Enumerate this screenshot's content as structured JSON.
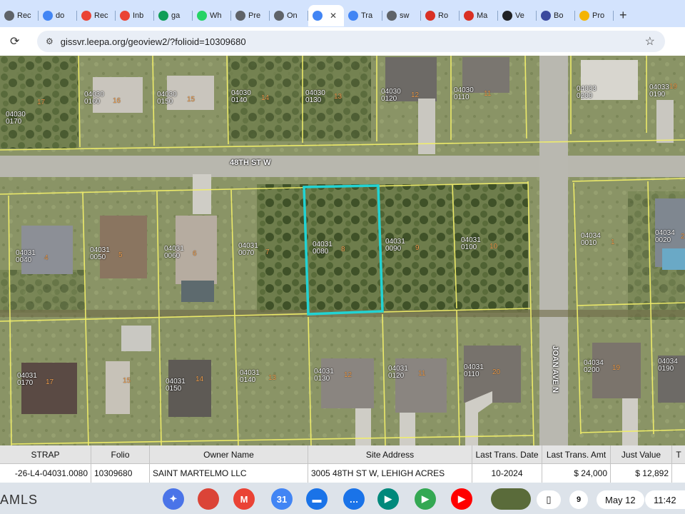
{
  "browser": {
    "tabs": [
      {
        "label": "Rec",
        "icon": "page-icon",
        "color": "#5f6368"
      },
      {
        "label": "do",
        "icon": "smiley-icon",
        "color": "#4285f4"
      },
      {
        "label": "Rec",
        "icon": "gmail-icon",
        "color": "#ea4335"
      },
      {
        "label": "Inb",
        "icon": "gmail-icon",
        "color": "#ea4335"
      },
      {
        "label": "ga",
        "icon": "sheets-icon",
        "color": "#0f9d58"
      },
      {
        "label": "Wh",
        "icon": "whatsapp-icon",
        "color": "#25d366"
      },
      {
        "label": "Pre",
        "icon": "globe-icon",
        "color": "#5f6368"
      },
      {
        "label": "On",
        "icon": "globe-icon",
        "color": "#5f6368"
      },
      {
        "label": "",
        "icon": "lens-icon",
        "color": "#4285f4",
        "active": true
      },
      {
        "label": "Tra",
        "icon": "translate-icon",
        "color": "#4285f4"
      },
      {
        "label": "sw",
        "icon": "globe-icon",
        "color": "#5f6368"
      },
      {
        "label": "Ro",
        "icon": "red-c-icon",
        "color": "#d93025"
      },
      {
        "label": "Ma",
        "icon": "red-c-icon",
        "color": "#d93025"
      },
      {
        "label": "Ve",
        "icon": "circle-logo-icon",
        "color": "#202124"
      },
      {
        "label": "Bo",
        "icon": "moon-icon",
        "color": "#3c4a9e"
      },
      {
        "label": "Pro",
        "icon": "warning-icon",
        "color": "#f4b400"
      }
    ],
    "new_tab_symbol": "+",
    "close_symbol": "✕",
    "url": "gissvr.leepa.org/geoview2/?folioid=10309680"
  },
  "map": {
    "streets": {
      "horizontal": "48TH ST W",
      "vertical": "JOAN AVE N"
    },
    "parcels": [
      {
        "id": "04030\n0170",
        "lot": "17"
      },
      {
        "id": "04030\n0160",
        "lot": "16"
      },
      {
        "id": "04030\n0150",
        "lot": "15"
      },
      {
        "id": "04030\n0140",
        "lot": "14"
      },
      {
        "id": "04030\n0130",
        "lot": "13"
      },
      {
        "id": "04030\n0120",
        "lot": "12"
      },
      {
        "id": "04030\n0110",
        "lot": "11"
      },
      {
        "id": "04033\n0200",
        "lot": ""
      },
      {
        "id": "04033\n0190",
        "lot": "19"
      },
      {
        "id": "04031\n0040",
        "lot": "4"
      },
      {
        "id": "04031\n0050",
        "lot": "5"
      },
      {
        "id": "04031\n0060",
        "lot": "6"
      },
      {
        "id": "04031\n0070",
        "lot": "7"
      },
      {
        "id": "04031\n0080",
        "lot": "8"
      },
      {
        "id": "04031\n0090",
        "lot": "9"
      },
      {
        "id": "04031\n0100",
        "lot": "10"
      },
      {
        "id": "04034\n0010",
        "lot": "1"
      },
      {
        "id": "04034\n0020",
        "lot": "2"
      },
      {
        "id": "04031\n0170",
        "lot": "17"
      },
      {
        "id": "04031\n0150",
        "lot": "15"
      },
      {
        "id": "04031\n0140",
        "lot": "14"
      },
      {
        "id": "04031\n0130",
        "lot": "13"
      },
      {
        "id": "04031\n0120",
        "lot": "12"
      },
      {
        "id": "04031\n0110",
        "lot": "11"
      },
      {
        "id": "04034\n0200",
        "lot": "20"
      },
      {
        "id": "04034\n0190",
        "lot": "19"
      }
    ],
    "selected_parcel": "04031\n0080",
    "colors": {
      "parcel_lines": "#f2ef6a",
      "selection": "#22d3d3"
    }
  },
  "table": {
    "headers": [
      "STRAP",
      "Folio",
      "Owner Name",
      "Site Address",
      "Last Trans. Date",
      "Last Trans. Amt",
      "Just Value",
      "T"
    ],
    "row": [
      "-26-L4-04031.0080",
      "10309680",
      "SAINT MARTELMO LLC",
      "3005 48TH ST W, LEHIGH ACRES",
      "10-2024",
      "$ 24,000",
      "$ 12,892",
      ""
    ]
  },
  "shelf": {
    "watermark": "AMLS",
    "apps": [
      {
        "name": "gemini-icon",
        "glyph": "✦",
        "color": "#4a74e8"
      },
      {
        "name": "chrome-icon",
        "glyph": "",
        "color": "#db4437"
      },
      {
        "name": "gmail-icon",
        "glyph": "M",
        "color": "#ea4335"
      },
      {
        "name": "calendar-icon",
        "glyph": "31",
        "color": "#4285f4"
      },
      {
        "name": "files-icon",
        "glyph": "▬",
        "color": "#1a73e8"
      },
      {
        "name": "messages-icon",
        "glyph": "…",
        "color": "#1a73e8"
      },
      {
        "name": "meet-icon",
        "glyph": "▶",
        "color": "#00897b"
      },
      {
        "name": "play-store-icon",
        "glyph": "▶",
        "color": "#34a853"
      },
      {
        "name": "youtube-icon",
        "glyph": "▶",
        "color": "#ff0000"
      },
      {
        "name": "photos-thumbnail-icon",
        "glyph": "",
        "color": "#5a6b3a"
      }
    ],
    "phone_symbol": "▯",
    "notification_count": "9",
    "date": "May 12",
    "time": "11:42"
  }
}
